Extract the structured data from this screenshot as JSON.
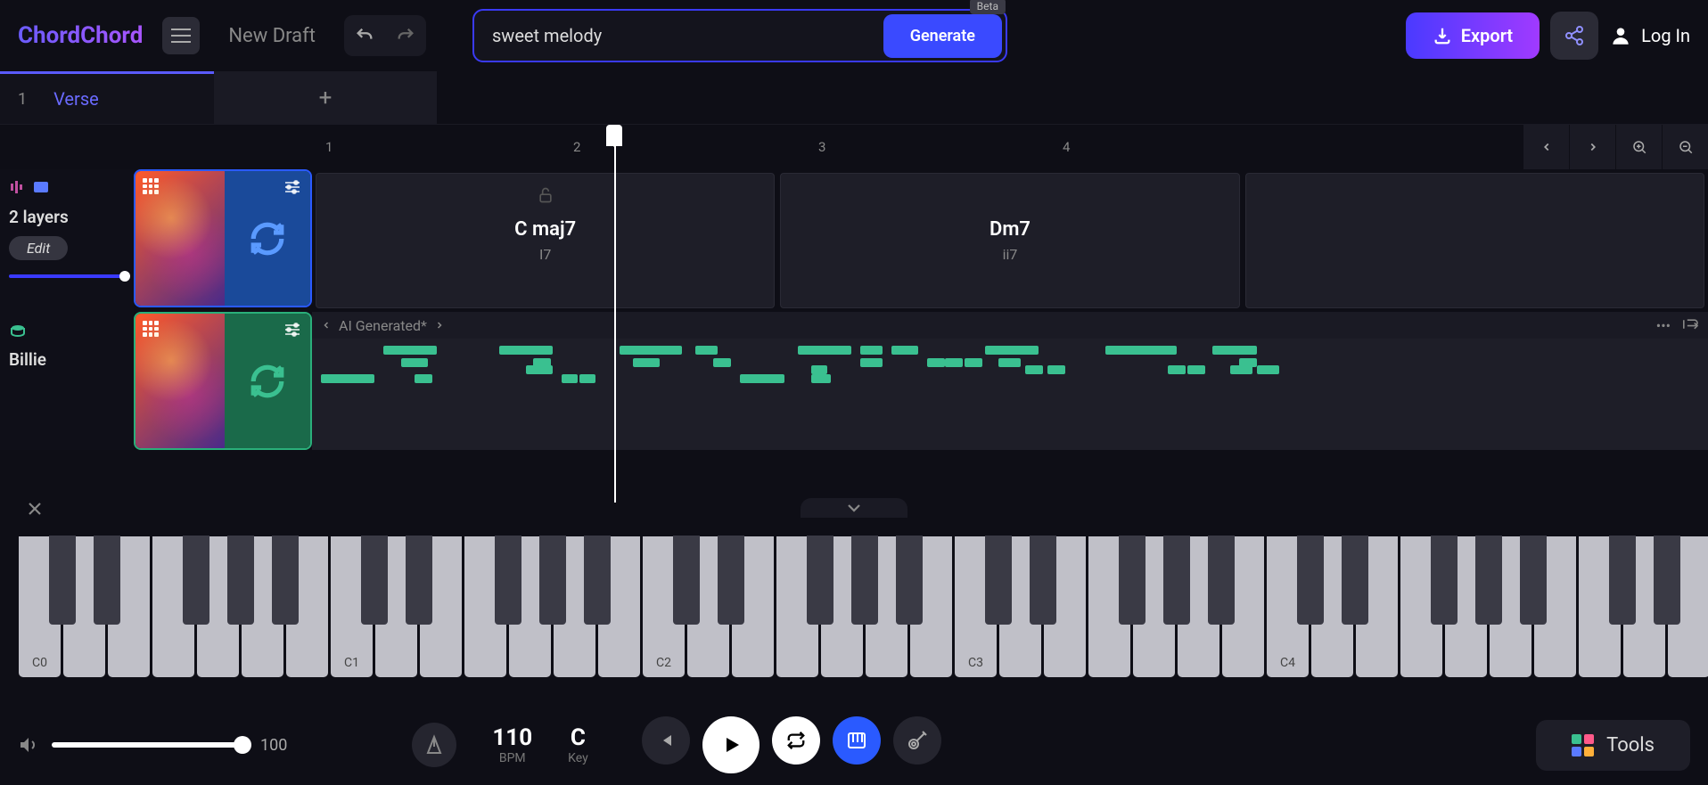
{
  "header": {
    "logo": "ChordChord",
    "draft_title": "New Draft",
    "prompt_value": "sweet melody",
    "generate_label": "Generate",
    "beta_label": "Beta",
    "export_label": "Export",
    "login_label": "Log In"
  },
  "tabs": {
    "items": [
      {
        "num": "1",
        "name": "Verse"
      }
    ]
  },
  "ruler": {
    "marks": [
      "1",
      "2",
      "3",
      "4"
    ]
  },
  "tracks": {
    "layers": {
      "label": "2 layers",
      "edit_label": "Edit",
      "volume": 100
    },
    "chords": [
      {
        "name": "C maj7",
        "roman": "I7"
      },
      {
        "name": "Dm7",
        "roman": "ii7"
      }
    ],
    "melody": {
      "name": "Billie",
      "header_label": "AI Generated*"
    }
  },
  "piano": {
    "labels": [
      "C0",
      "C1",
      "C2",
      "C3",
      "C4"
    ]
  },
  "transport": {
    "volume": "100",
    "bpm_value": "110",
    "bpm_label": "BPM",
    "key_value": "C",
    "key_label": "Key",
    "tools_label": "Tools"
  },
  "colors": {
    "accent": "#3a4aff",
    "green": "#3ac090"
  }
}
